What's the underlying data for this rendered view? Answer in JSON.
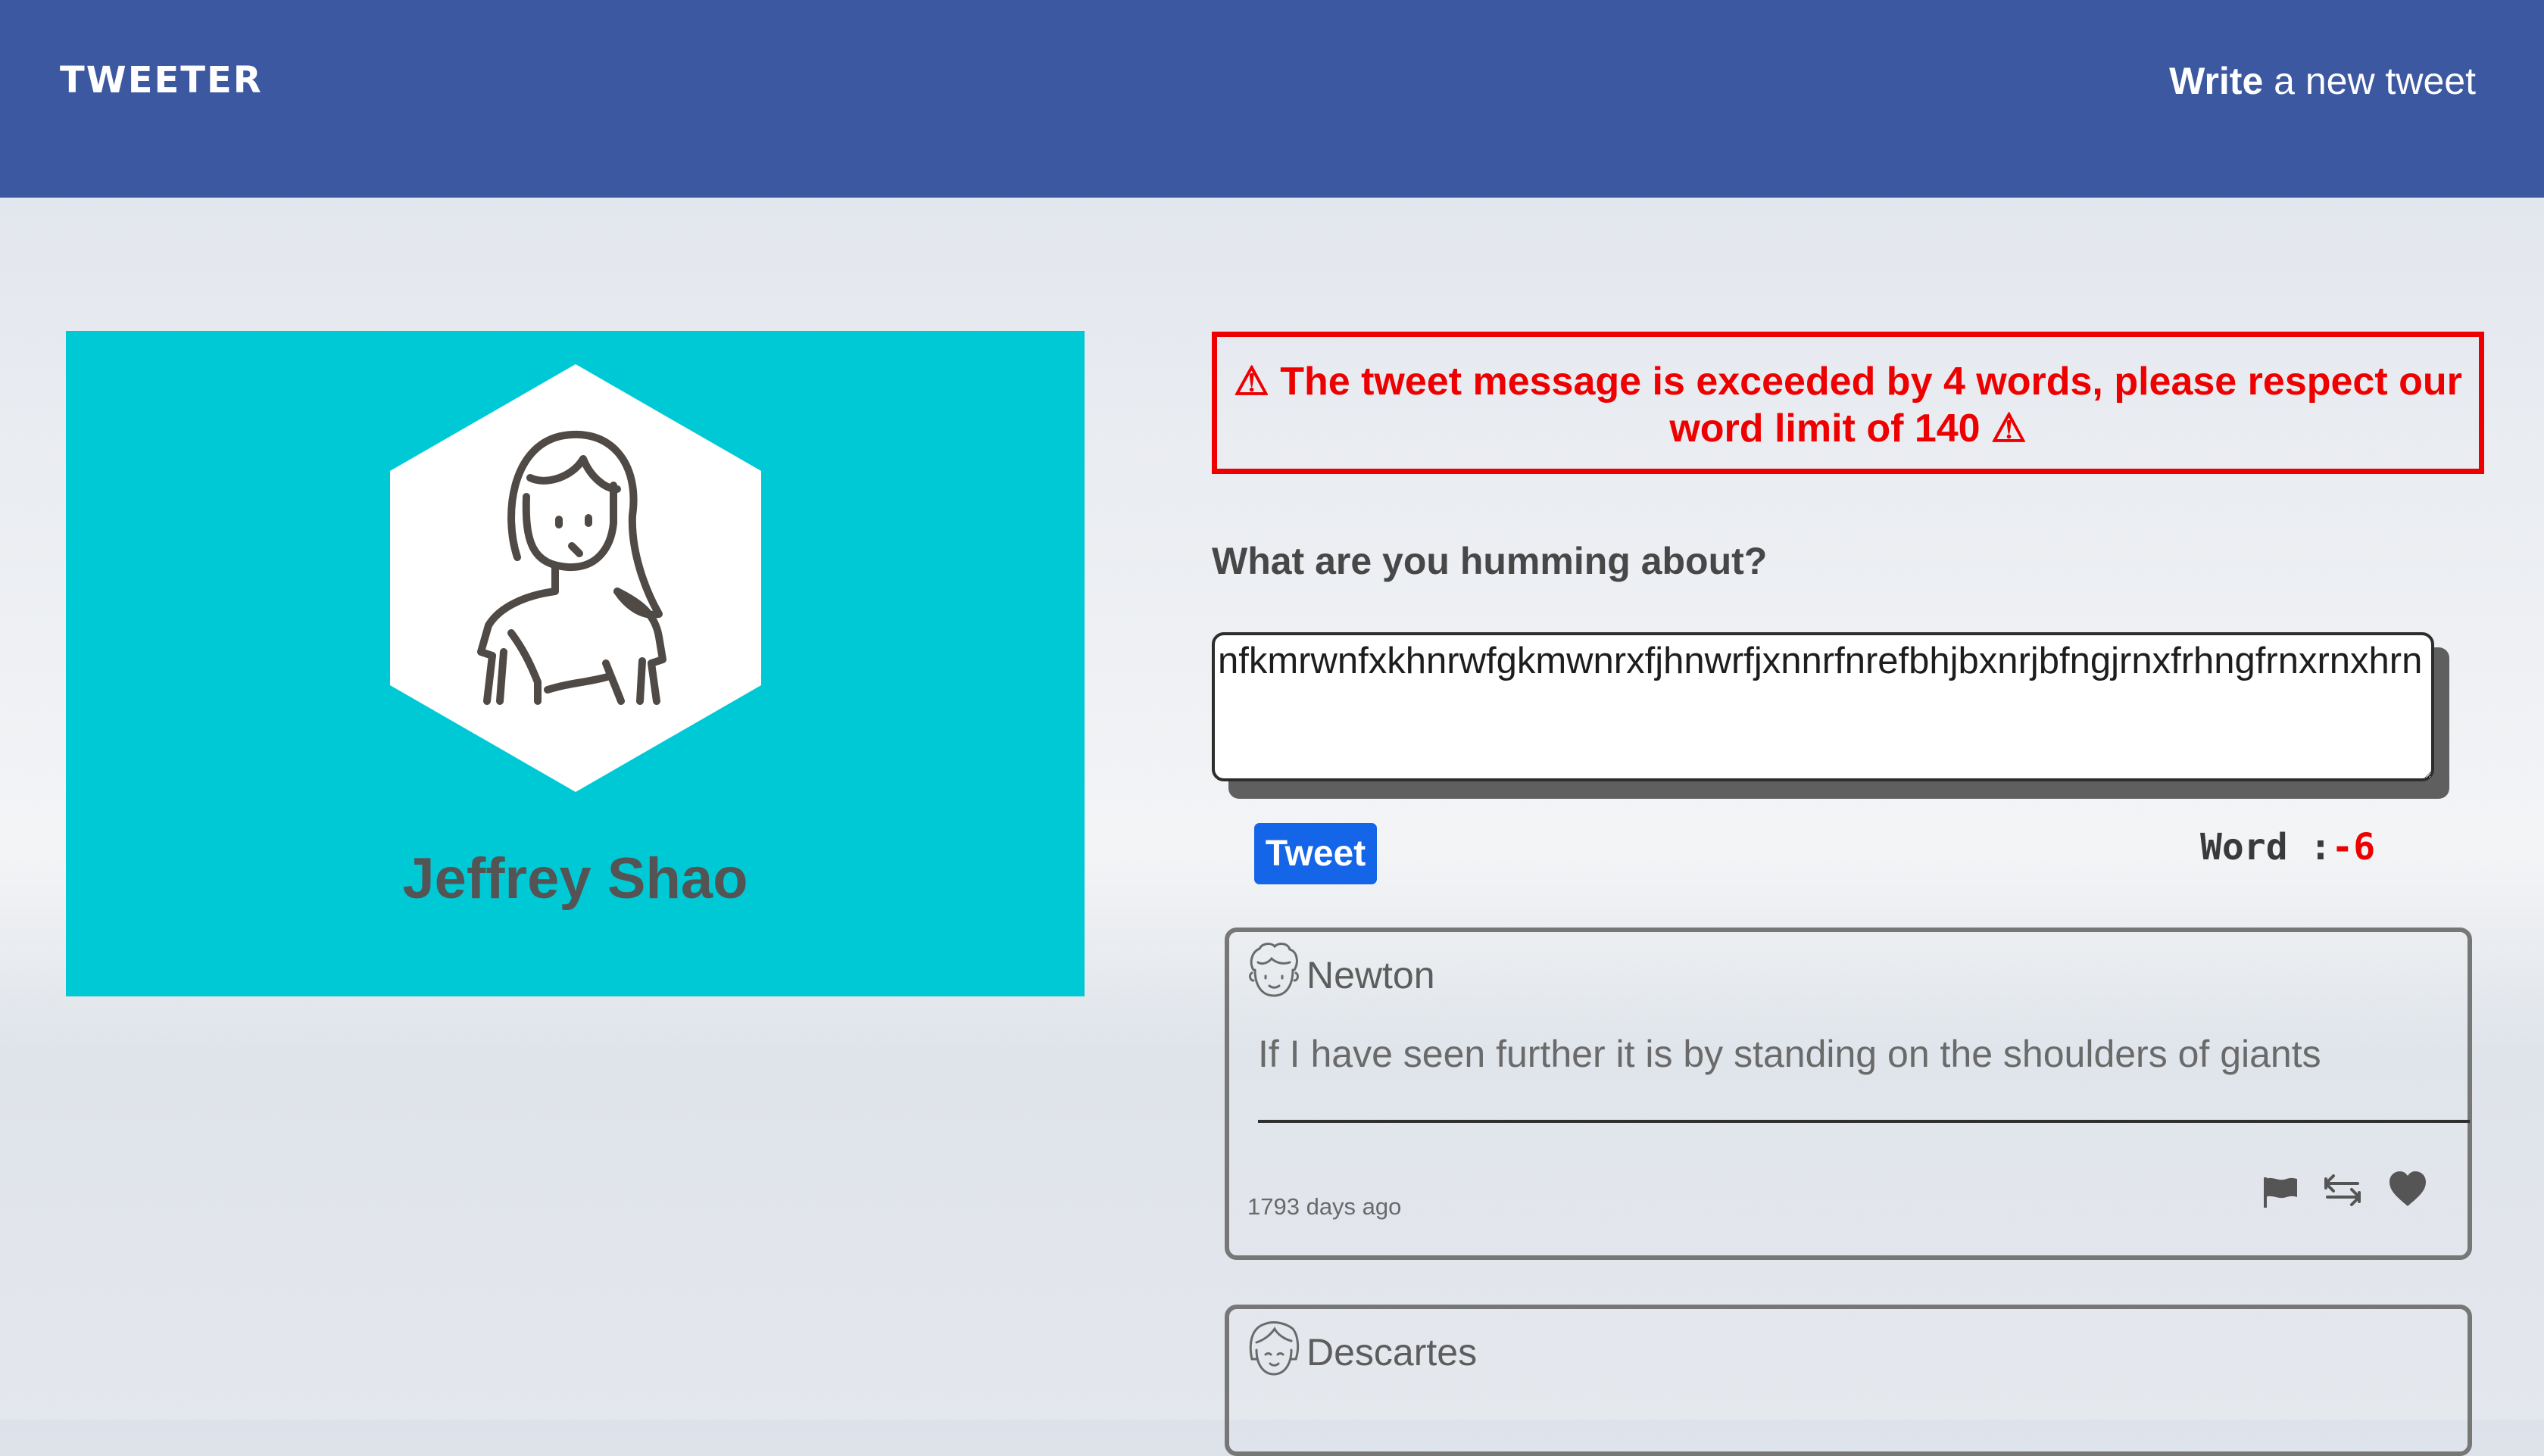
{
  "header": {
    "brand": "TWEETER",
    "write_strong": "Write",
    "write_rest": " a new tweet"
  },
  "profile": {
    "name": "Jeffrey Shao",
    "background_color": "#00c9d6",
    "avatar_icon": "woman-avatar-icon"
  },
  "alert": {
    "icon": "warning-icon",
    "message": "⚠ The tweet message is exceeded by 4 words, please respect our word limit of 140 ⚠",
    "color": "#ee0000"
  },
  "composer": {
    "prompt": "What are you humming about?",
    "text": "nfkmrwnfxkhnrwfgkmwnrxfjhnwrfjxnnrfnrefbhjbxnrjbfngjrnxfrhngfrnxrnxhrn",
    "button_label": "Tweet",
    "counter_label": "Word :",
    "counter_value": "-6",
    "button_color": "#1565e8"
  },
  "tweets": [
    {
      "author": "Newton",
      "avatar_icon": "curly-hair-face-icon",
      "text": "If I have seen further it is by standing on the shoulders of giants",
      "time": "1793 days ago",
      "actions": [
        "flag-icon",
        "retweet-icon",
        "heart-icon"
      ]
    },
    {
      "author": "Descartes",
      "avatar_icon": "bob-hair-face-icon"
    }
  ],
  "colors": {
    "header": "#3c58a0",
    "card_border": "#777777"
  }
}
